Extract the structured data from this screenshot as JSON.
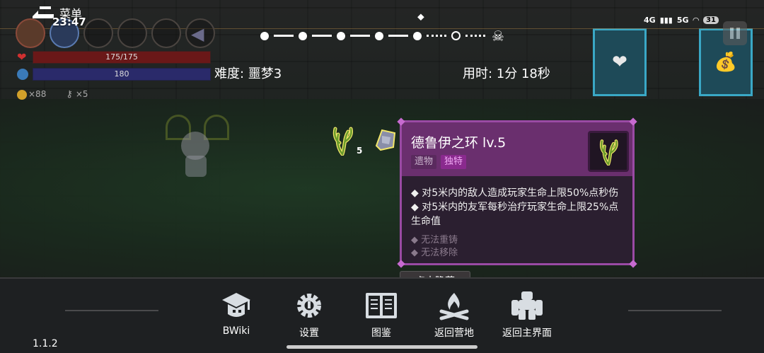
{
  "status_bar": {
    "menu_label": "菜单",
    "clock": "23:47",
    "network_1": "4G",
    "network_2": "5G",
    "battery": "31"
  },
  "player": {
    "hp_text": "175/175",
    "mp_text": "180",
    "coins": "×88",
    "keys": "×5"
  },
  "run": {
    "difficulty": "难度: 噩梦3",
    "elapsed": "用时: 1分 18秒",
    "progress": {
      "cleared": 5,
      "current": 6,
      "total": 7
    }
  },
  "relics": {
    "first_level": "5"
  },
  "tooltip": {
    "title": "德鲁伊之环 lv.5",
    "tag_relic": "遗物",
    "tag_unique": "独特",
    "desc_1": "◆ 对5米内的敌人造成玩家生命上限50%点秒伤",
    "desc_2": "◆ 对5米内的友军每秒治疗玩家生命上限25%点",
    "desc_3": "生命值",
    "flag_1": "◆ 无法重铸",
    "flag_2": "◆ 无法移除"
  },
  "hide_button": "点击隐藏",
  "bottom_menu": {
    "bwiki": "BWiki",
    "settings": "设置",
    "codex": "图鉴",
    "return_camp": "返回营地",
    "return_main": "返回主界面"
  },
  "version": "1.1.2",
  "colors": {
    "tooltip_header": "#6a2f6e",
    "tooltip_border": "#9a4aa4",
    "tag_unique": "#8a2a8e"
  }
}
